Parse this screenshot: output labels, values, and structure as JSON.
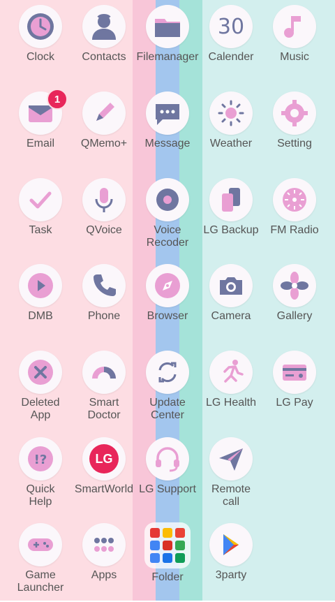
{
  "apps": [
    {
      "label": "Clock"
    },
    {
      "label": "Contacts"
    },
    {
      "label": "Filemanager"
    },
    {
      "label": "Calender",
      "icon_text": "30"
    },
    {
      "label": "Music"
    },
    {
      "label": "Email",
      "badge": "1"
    },
    {
      "label": "QMemo+"
    },
    {
      "label": "Message"
    },
    {
      "label": "Weather"
    },
    {
      "label": "Setting"
    },
    {
      "label": "Task"
    },
    {
      "label": "QVoice"
    },
    {
      "label": "Voice\nRecoder"
    },
    {
      "label": "LG Backup"
    },
    {
      "label": "FM Radio"
    },
    {
      "label": "DMB"
    },
    {
      "label": "Phone"
    },
    {
      "label": "Browser"
    },
    {
      "label": "Camera"
    },
    {
      "label": "Gallery"
    },
    {
      "label": "Deleted\nApp"
    },
    {
      "label": "Smart\nDoctor"
    },
    {
      "label": "Update\nCenter"
    },
    {
      "label": "LG Health"
    },
    {
      "label": "LG Pay"
    },
    {
      "label": "Quick\nHelp"
    },
    {
      "label": "SmartWorld",
      "icon_text": "LG"
    },
    {
      "label": "LG Support"
    },
    {
      "label": "Remote\ncall"
    },
    {
      "label": "Game\nLauncher"
    },
    {
      "label": "Apps"
    },
    {
      "label": "Folder"
    },
    {
      "label": "3party"
    }
  ],
  "colors": {
    "navy": "#6f76a0",
    "pink": "#e99fd3",
    "badge": "#e8265a",
    "label": "#555555"
  }
}
